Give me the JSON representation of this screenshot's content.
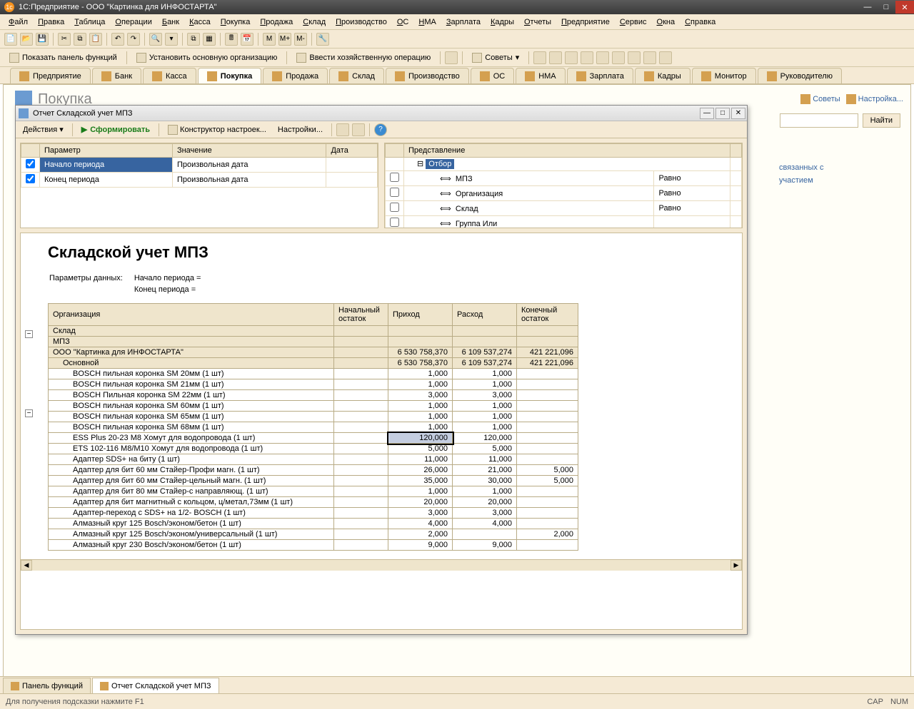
{
  "title": "1С:Предприятие - ООО \"Картинка для ИНФОСТАРТА\"",
  "menu": [
    "Файл",
    "Правка",
    "Таблица",
    "Операции",
    "Банк",
    "Касса",
    "Покупка",
    "Продажа",
    "Склад",
    "Производство",
    "ОС",
    "НМА",
    "Зарплата",
    "Кадры",
    "Отчеты",
    "Предприятие",
    "Сервис",
    "Окна",
    "Справка"
  ],
  "toolbar2": {
    "btn1": "Показать панель функций",
    "btn2": "Установить основную организацию",
    "btn3": "Ввести хозяйственную операцию",
    "btn4": "Советы"
  },
  "tb_letters": {
    "m": "M",
    "mp": "M+",
    "mm": "M-"
  },
  "sections": [
    "Предприятие",
    "Банк",
    "Касса",
    "Покупка",
    "Продажа",
    "Склад",
    "Производство",
    "ОС",
    "НМА",
    "Зарплата",
    "Кадры",
    "Монитор",
    "Руководителю"
  ],
  "activeSection": 3,
  "page": {
    "title": "Покупка",
    "tips": "Советы",
    "settings": "Настройка...",
    "find": "Найти",
    "link1": "связанных с",
    "link2": "участием"
  },
  "report": {
    "title": "Отчет  Складской учет МПЗ",
    "toolbar": {
      "actions": "Действия",
      "form": "Сформировать",
      "constructor": "Конструктор настроек...",
      "settings": "Настройки..."
    },
    "paramGrid": {
      "headers": [
        "Параметр",
        "Значение",
        "Дата"
      ],
      "rows": [
        {
          "chk": true,
          "param": "Начало периода",
          "val": "Произвольная дата",
          "date": "",
          "sel": true
        },
        {
          "chk": true,
          "param": "Конец периода",
          "val": "Произвольная дата",
          "date": ""
        }
      ]
    },
    "filterGrid": {
      "header": "Представление",
      "root": "Отбор",
      "rows": [
        {
          "chk": false,
          "name": "МПЗ",
          "cond": "Равно"
        },
        {
          "chk": false,
          "name": "Организация",
          "cond": "Равно"
        },
        {
          "chk": false,
          "name": "Склад",
          "cond": "Равно"
        },
        {
          "chk": false,
          "name": "Группа Или",
          "cond": ""
        }
      ]
    },
    "body": {
      "h1": "Складской учет МПЗ",
      "paramLabel": "Параметры данных:",
      "p1": "Начало периода =",
      "p2": "Конец периода =",
      "cols": [
        "Организация",
        "Начальный остаток",
        "Приход",
        "Расход",
        "Конечный остаток"
      ],
      "sub1": "Склад",
      "sub2": "МПЗ",
      "rows": [
        {
          "lvl": 0,
          "name": "ООО \"Картинка для ИНФОСТАРТА\"",
          "in": "6 530 758,370",
          "out": "6 109 537,274",
          "end": "421 221,096",
          "grp": true
        },
        {
          "lvl": 1,
          "name": "Основной",
          "in": "6 530 758,370",
          "out": "6 109 537,274",
          "end": "421 221,096",
          "grp": true
        },
        {
          "lvl": 2,
          "name": "BOSCH пильная коронка SM 20мм (1 шт)",
          "in": "1,000",
          "out": "1,000"
        },
        {
          "lvl": 2,
          "name": "BOSCH пильная коронка SM 21мм (1 шт)",
          "in": "1,000",
          "out": "1,000"
        },
        {
          "lvl": 2,
          "name": "BOSCH Пильная коронка SM 22мм (1 шт)",
          "in": "3,000",
          "out": "3,000"
        },
        {
          "lvl": 2,
          "name": "BOSCH пильная коронка SM 60мм (1 шт)",
          "in": "1,000",
          "out": "1,000"
        },
        {
          "lvl": 2,
          "name": "BOSCH пильная коронка SM 65мм (1 шт)",
          "in": "1,000",
          "out": "1,000"
        },
        {
          "lvl": 2,
          "name": "BOSCH пильная коронка SM 68мм (1 шт)",
          "in": "1,000",
          "out": "1,000"
        },
        {
          "lvl": 2,
          "name": "ESS Plus 20-23 M8 Хомут для водопровода    (1 шт)",
          "in": "120,000",
          "out": "120,000",
          "sel": true
        },
        {
          "lvl": 2,
          "name": "ETS 102-116 M8/M10  Хомут для водопровода    (1 шт)",
          "in": "5,000",
          "out": "5,000"
        },
        {
          "lvl": 2,
          "name": "Адаптер SDS+ на биту         (1 шт)",
          "in": "11,000",
          "out": "11,000"
        },
        {
          "lvl": 2,
          "name": "Адаптер для бит 60 мм Стайер-Профи  магн.    (1 шт)",
          "in": "26,000",
          "out": "21,000",
          "end": "5,000"
        },
        {
          "lvl": 2,
          "name": "Адаптер для бит 60 мм Стайер-цельный магн.  (1 шт)",
          "in": "35,000",
          "out": "30,000",
          "end": "5,000"
        },
        {
          "lvl": 2,
          "name": "Адаптер для бит 80 мм Стайер-с направляющ.  (1 шт)",
          "in": "1,000",
          "out": "1,000"
        },
        {
          "lvl": 2,
          "name": "Адаптер для бит магнитный с кольцом, ц/метал,73мм (1 шт)",
          "in": "20,000",
          "out": "20,000"
        },
        {
          "lvl": 2,
          "name": "Адаптер-переход с SDS+ на 1/2- BOSCH       (1 шт)",
          "in": "3,000",
          "out": "3,000"
        },
        {
          "lvl": 2,
          "name": "Алмазный круг 125 Bosch/эконом/бетон  (1 шт)",
          "in": "4,000",
          "out": "4,000"
        },
        {
          "lvl": 2,
          "name": "Алмазный круг 125 Bosch/эконом/универсальный (1 шт)",
          "in": "2,000",
          "out": "",
          "end": "2,000"
        },
        {
          "lvl": 2,
          "name": "Алмазный круг 230 Bosch/эконом/бетон (1 шт)",
          "in": "9,000",
          "out": "9,000"
        }
      ]
    }
  },
  "bottomTabs": [
    "Панель функций",
    "Отчет  Складской учет МПЗ"
  ],
  "status": {
    "hint": "Для получения подсказки нажмите F1",
    "cap": "CAP",
    "num": "NUM"
  }
}
